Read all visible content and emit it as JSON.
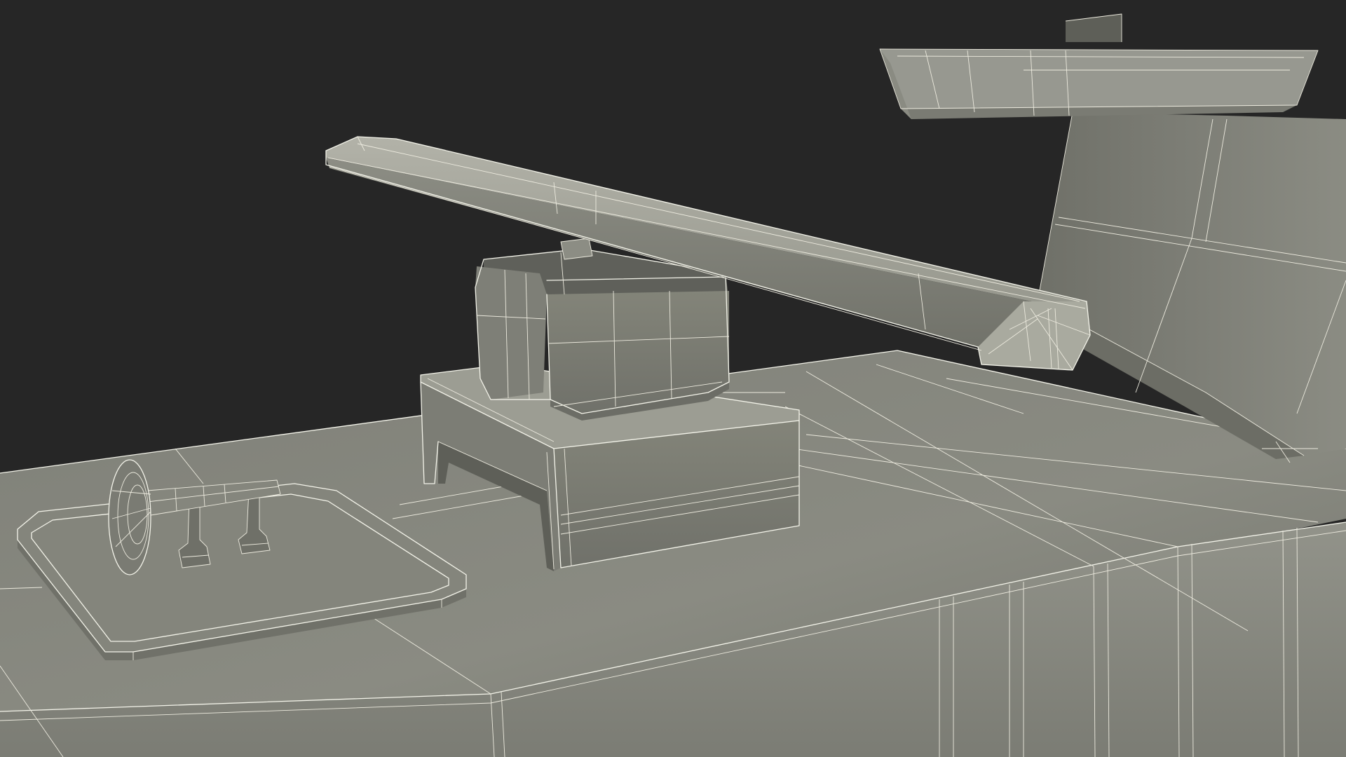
{
  "scene": {
    "kind": "3d-model-wireframe-render",
    "colors": {
      "background": "#262626",
      "surface_light": "#8f9086",
      "surface_mid": "#7f8077",
      "surface_dark": "#6a6b63",
      "surface_shadow": "#56574f",
      "wire": "#f4f4ea"
    },
    "objects": [
      "deck",
      "horn",
      "horn-base-plate",
      "radar-pedestal",
      "radar-gearbox",
      "radar-antenna",
      "mast",
      "mast-platform"
    ]
  }
}
